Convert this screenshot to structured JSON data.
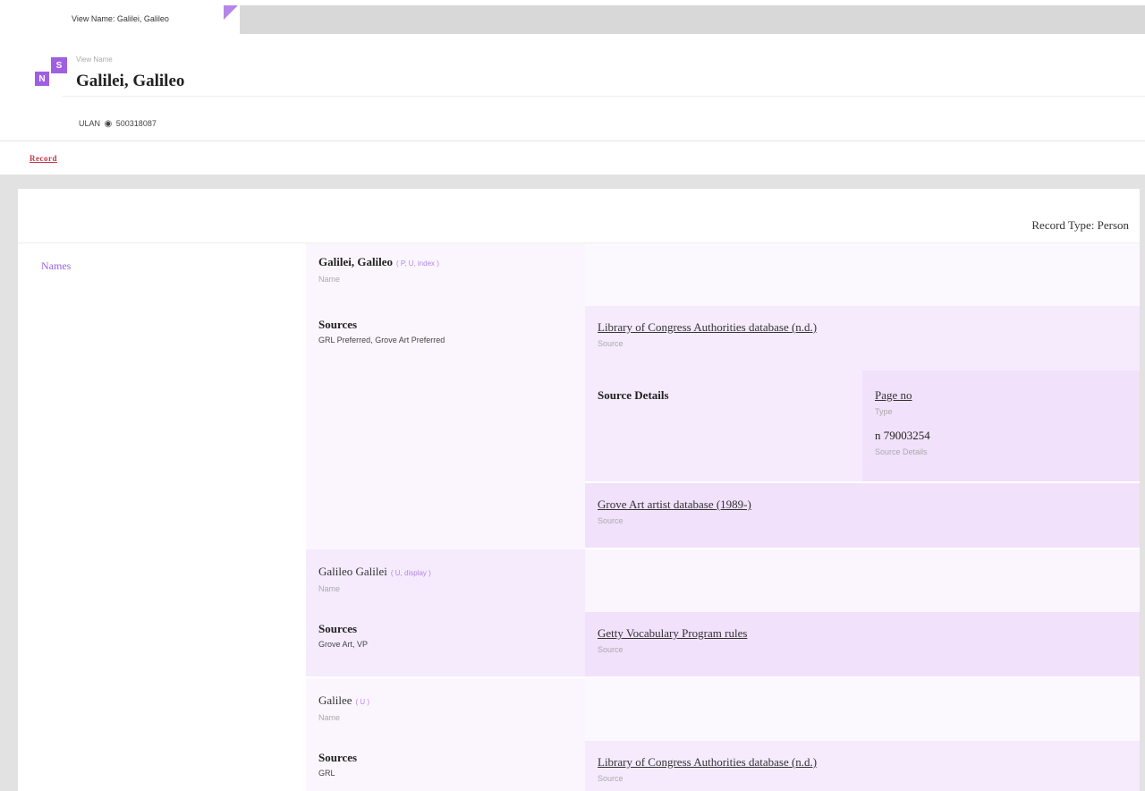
{
  "tab": {
    "label": "View Name: Galilei, Galileo"
  },
  "logo": {
    "letter_top": "S",
    "letter_bottom": "N"
  },
  "header": {
    "caption": "View Name",
    "title": "Galilei, Galileo",
    "ulan_prefix": "ULAN",
    "ulan_id": "500318087"
  },
  "nav": {
    "record_link": "Record"
  },
  "panel": {
    "record_type": "Record Type: Person",
    "section_label": "Names"
  },
  "names": [
    {
      "name": "Galilei, Galileo",
      "meta": "( P, U, index )",
      "caption": "Name",
      "sources_heading": "Sources",
      "sources_text": "GRL Preferred, Grove Art Preferred"
    },
    {
      "name": "Galileo Galilei",
      "meta": "( U, display )",
      "caption": "Name",
      "sources_heading": "Sources",
      "sources_text": "Grove Art, VP"
    },
    {
      "name": "Galilee",
      "meta": "( U )",
      "caption": "Name",
      "sources_heading": "Sources",
      "sources_text": "GRL"
    }
  ],
  "sources": {
    "loc_1": {
      "title": "Library of Congress Authorities database (n.d.)",
      "caption": "Source"
    },
    "source_details_heading": "Source Details",
    "type_link": "Page no",
    "type_caption": "Type",
    "details_value": "n 79003254",
    "details_caption": "Source Details",
    "grove": {
      "title": "Grove Art artist database (1989-)",
      "caption": "Source"
    },
    "getty": {
      "title": "Getty Vocabulary Program rules",
      "caption": "Source"
    },
    "loc_2": {
      "title": "Library of Congress Authorities database (n.d.)",
      "caption": "Source"
    }
  }
}
